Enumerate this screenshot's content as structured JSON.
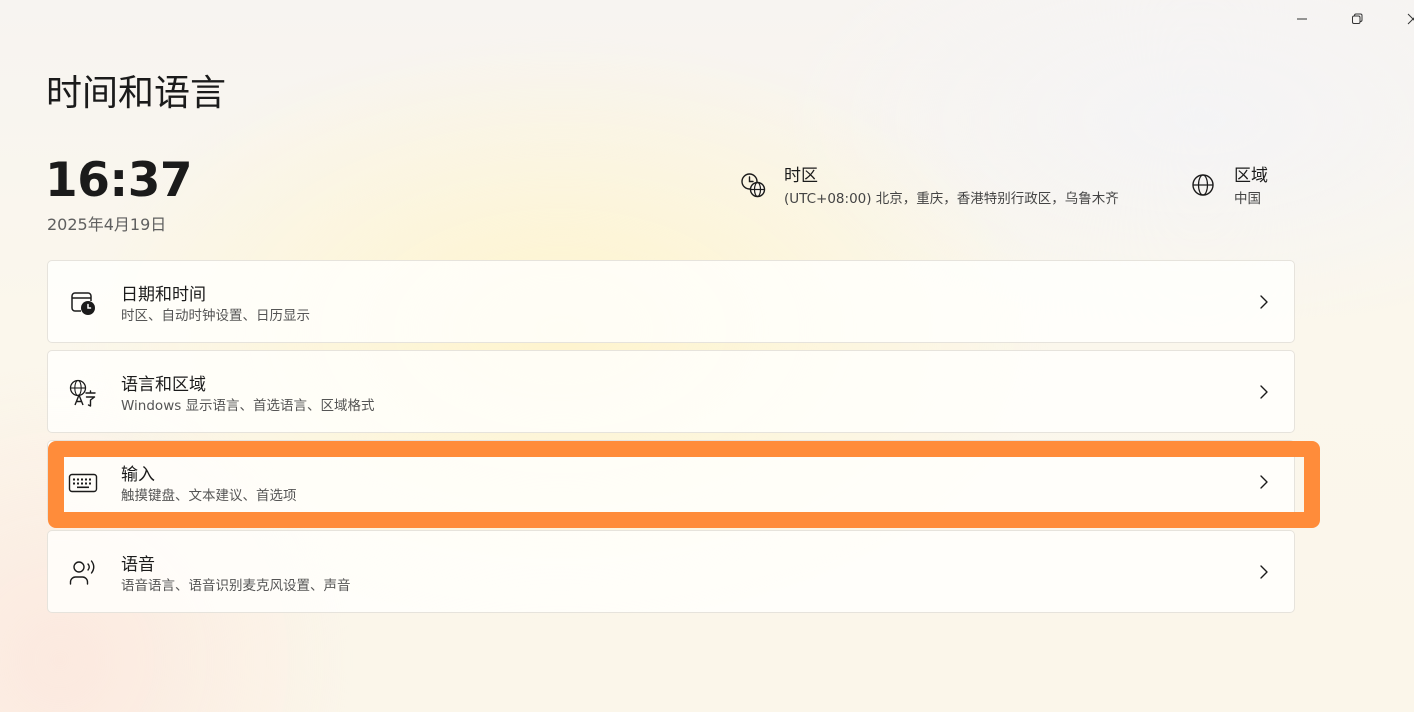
{
  "window": {
    "minimize_icon": "minimize-icon",
    "maximize_icon": "restore-icon",
    "close_icon": "close-icon"
  },
  "header": {
    "title": "时间和语言"
  },
  "clock": {
    "time": "16:37",
    "date": "2025年4月19日"
  },
  "timezone": {
    "icon": "clock-globe-icon",
    "title": "时区",
    "value": "(UTC+08:00) 北京，重庆，香港特别行政区，乌鲁木齐"
  },
  "region": {
    "icon": "globe-icon",
    "title": "区域",
    "value": "中国"
  },
  "settings": {
    "items": [
      {
        "icon": "calendar-clock-icon",
        "title": "日期和时间",
        "subtitle": "时区、自动时钟设置、日历显示"
      },
      {
        "icon": "language-icon",
        "title": "语言和区域",
        "subtitle": "Windows 显示语言、首选语言、区域格式"
      },
      {
        "icon": "keyboard-icon",
        "title": "输入",
        "subtitle": "触摸键盘、文本建议、首选项",
        "highlighted": true
      },
      {
        "icon": "speech-icon",
        "title": "语音",
        "subtitle": "语音语言、语音识别麦克风设置、声音"
      }
    ]
  },
  "colors": {
    "highlight": "#ff8c3a",
    "card_background": "#fffffd",
    "card_border": "#e6e3dc"
  }
}
